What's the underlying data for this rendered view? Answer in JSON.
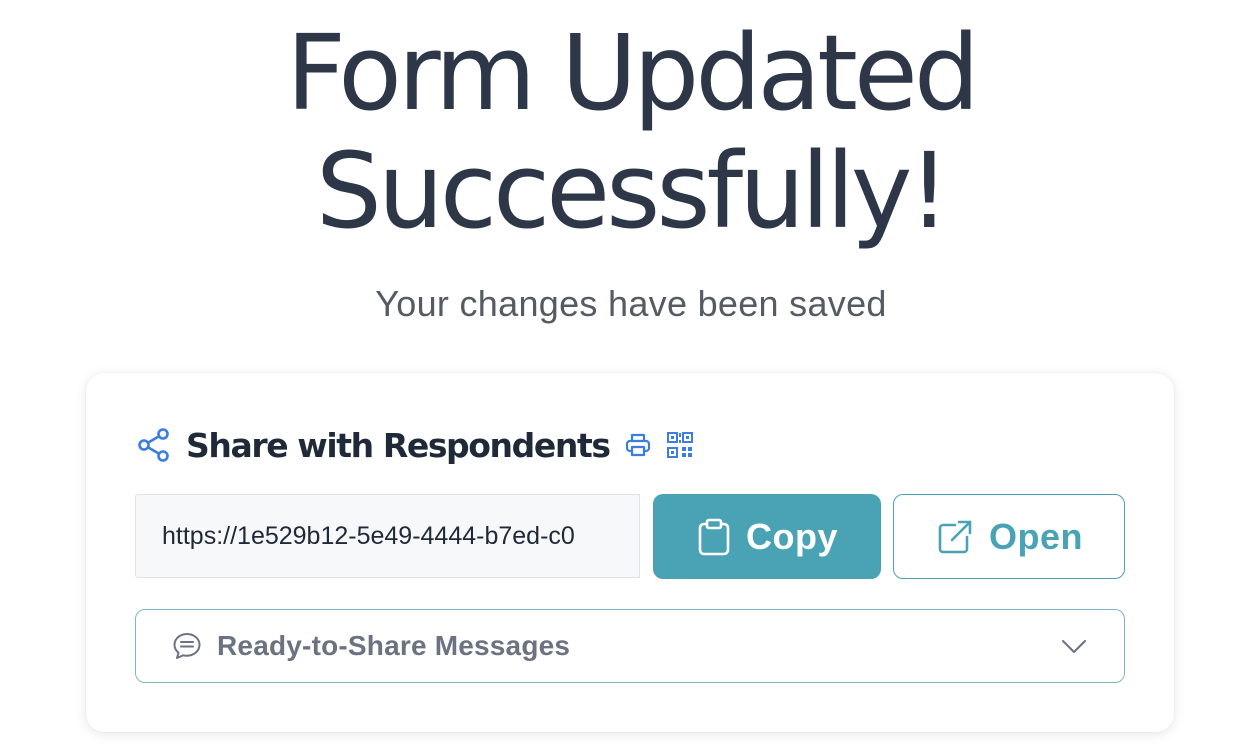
{
  "hero": {
    "title_line1": "Form Updated",
    "title_line2": "Successfully!",
    "subtitle": "Your changes have been saved"
  },
  "share": {
    "title": "Share with Respondents",
    "url": "https://1e529b12-5e49-4444-b7ed-c0",
    "copy_label": "Copy",
    "open_label": "Open",
    "messages_label": "Ready-to-Share Messages"
  },
  "colors": {
    "accent": "#4aa3b5",
    "icon_blue": "#3b7de0",
    "heading": "#2d3748"
  },
  "icons": {
    "share": "share-icon",
    "print": "printer-icon",
    "qr": "qr-code-icon",
    "copy": "clipboard-icon",
    "open": "external-link-icon",
    "messages": "chat-bubble-icon",
    "expand": "chevron-down-icon"
  }
}
